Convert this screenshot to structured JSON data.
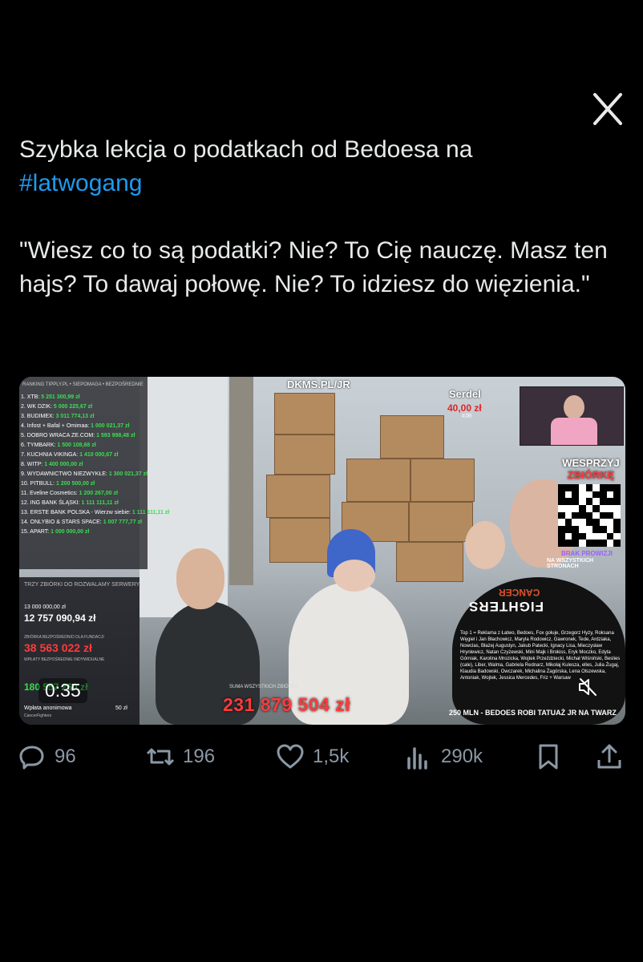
{
  "tweet": {
    "line1": "Szybka lekcja o podatkach od Bedoesa na",
    "hashtag": "#latwogang",
    "quote": "\"Wiesz co to są podatki? Nie? To Cię nauczę. Masz ten hajs? To dawaj połowę. Nie? To idziesz do więzienia.\""
  },
  "video": {
    "timer": "0:35",
    "dkms": "DKMS.PL/JR",
    "serdel_name": "Serdel",
    "serdel_amount": "40,00 zł",
    "serdel_sub": "#JR",
    "support_line1": "WESPRZYJ",
    "support_line2": "ZBIÓRKĘ",
    "no_commission": "BRAK PROWIZJI",
    "all_pages": "NA WSZYSTKICH STRONACH",
    "ranking_header": "RANKING  TIPPLY.PL • SIEPOMAGA • BEZPOŚREDNIE",
    "ranking": [
      {
        "label": "1. XTB:",
        "amount": "5 251 300,99 zł"
      },
      {
        "label": "2. WK DZIK:",
        "amount": "5 000 225,67 zł"
      },
      {
        "label": "3. BUDIMEX:",
        "amount": "3 011 774,13 zł"
      },
      {
        "label": "4. Infost + Bafal + Omimaa:",
        "amount": "1 000 021,37 zł"
      },
      {
        "label": "5. DOBRO WRACA ZE.COM:",
        "amount": "1 593 998,48 zł"
      },
      {
        "label": "6. TYMBARK:",
        "amount": "1 500 108,68 zł"
      },
      {
        "label": "7. KUCHNIA VIKINGA:",
        "amount": "1 410 000,67 zł"
      },
      {
        "label": "8. WITP:",
        "amount": "1 400 000,00 zł"
      },
      {
        "label": "9. WYDAWNICTWO NIEZWYKŁE:",
        "amount": "1 300 021,37 zł"
      },
      {
        "label": "10. PITBULL:",
        "amount": "1 200 500,00 zł"
      },
      {
        "label": "11. Eveline Cosmetics:",
        "amount": "1 200 267,00 zł"
      },
      {
        "label": "12. ING BANK ŚLĄSKI:",
        "amount": "1 111 111,11 zł"
      },
      {
        "label": "13. ERSTE BANK POLSKA - Wierzw siebie:",
        "amount": "1 111 111,11 zł"
      },
      {
        "label": "14. ONLYBIO & STARS SPACE:",
        "amount": "1 007 777,77 zł"
      },
      {
        "label": "15. APART:",
        "amount": "1 000 000,00 zł"
      }
    ],
    "stats_header": "TRZY ZBIÓRKI DO ROZWALAMY SERWERY",
    "goal": "13 000 000,00 zł",
    "stat1": "12 757 090,94 zł",
    "stat2_label": "ZBIÓRKA BEZPOŚREDNIO DLA FUNDACJI",
    "stat2": "38 563 022 zł",
    "stat3_label": "WPŁATY BEZPOŚREDNIE INDYWIDUALNE",
    "stat3": "180 557 260 zł",
    "anon_label": "Wpłata anonimowa",
    "anon_amount": "50 zł",
    "anon_sub": "CancerFighters",
    "total_label": "SUMA WSZYSTKICH ZBIÓREK",
    "total": "231 879 504 zł",
    "tattoo_ticker": "250 MLN - BEDOES ROBI TATUAŻ JR NA TWARZ",
    "shirt_text": "CANCER FIGHTERS",
    "credits": "Top 1 = Reklama z Łatwo, Bedoes, Fox gołuje, Grzegorz Hyży, Roksana Węgiel i Jan Błachowicz, Maryla Rodowicz, Gawronek, Tede, Ardziaka, Nowclas, Błażej Augustyn, Jakub Patecki, Ignacy Lisa, Mieczysław Hrynlewicz, Natan Czyżewski, Mini Majk i Brokiss, Eryk Moczko, Edyta Górniak, Karolina Mrozicka, Wojtek Przeździecki, Michał Wiśniński, Beslies (cale), Liber, Walma, Gabriela Rednarz, Mikołaj Kuleszа, elles, Julia Żugaj, Klaudia Badowski, Owczarek, Michalina Żagórska, Lena Olszewska, Antoniak, Wojtek, Jessica Mercedes, Friz + Warsaw"
  },
  "actions": {
    "replies": "96",
    "reposts": "196",
    "likes": "1,5k",
    "views": "290k"
  },
  "icons": [
    "close-icon",
    "reply-icon",
    "repost-icon",
    "like-icon",
    "views-icon",
    "bookmark-icon",
    "share-icon",
    "mute-icon"
  ],
  "colors": {
    "background": "#000000",
    "text": "#e7e9ea",
    "hashtag": "#1d9bf0",
    "muted": "#8b98a5",
    "counter_red": "#ff3b3b",
    "ranking_green": "#3ddc52"
  }
}
